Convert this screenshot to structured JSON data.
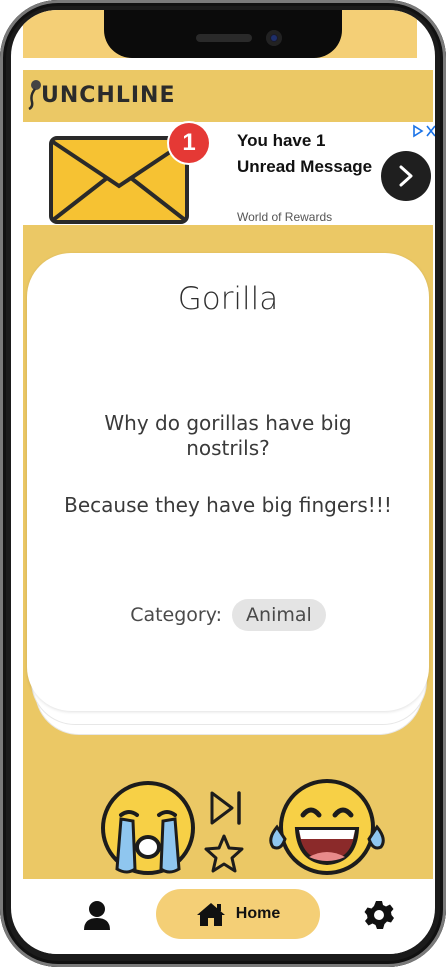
{
  "app": {
    "logo_text": "UNCHLINE"
  },
  "ad": {
    "badge_count": "1",
    "headline": "You have 1 Unread Message",
    "advertiser": "World of Rewards"
  },
  "joke": {
    "title": "Gorilla",
    "setup": "Why do gorillas have big nostrils?",
    "punchline": "Because they have big fingers!!!",
    "category_label": "Category:",
    "category": "Animal"
  },
  "nav": {
    "home_label": "Home"
  },
  "colors": {
    "brand_yellow": "#ebc865",
    "home_pill": "#f4cf76",
    "ad_badge": "#e53935"
  },
  "icons": [
    "microphone-icon",
    "envelope-icon",
    "ad-choices-icon",
    "chevron-right-icon",
    "crying-emoji-icon",
    "skip-next-icon",
    "star-icon",
    "laughing-emoji-icon",
    "user-icon",
    "home-icon",
    "gear-icon"
  ]
}
